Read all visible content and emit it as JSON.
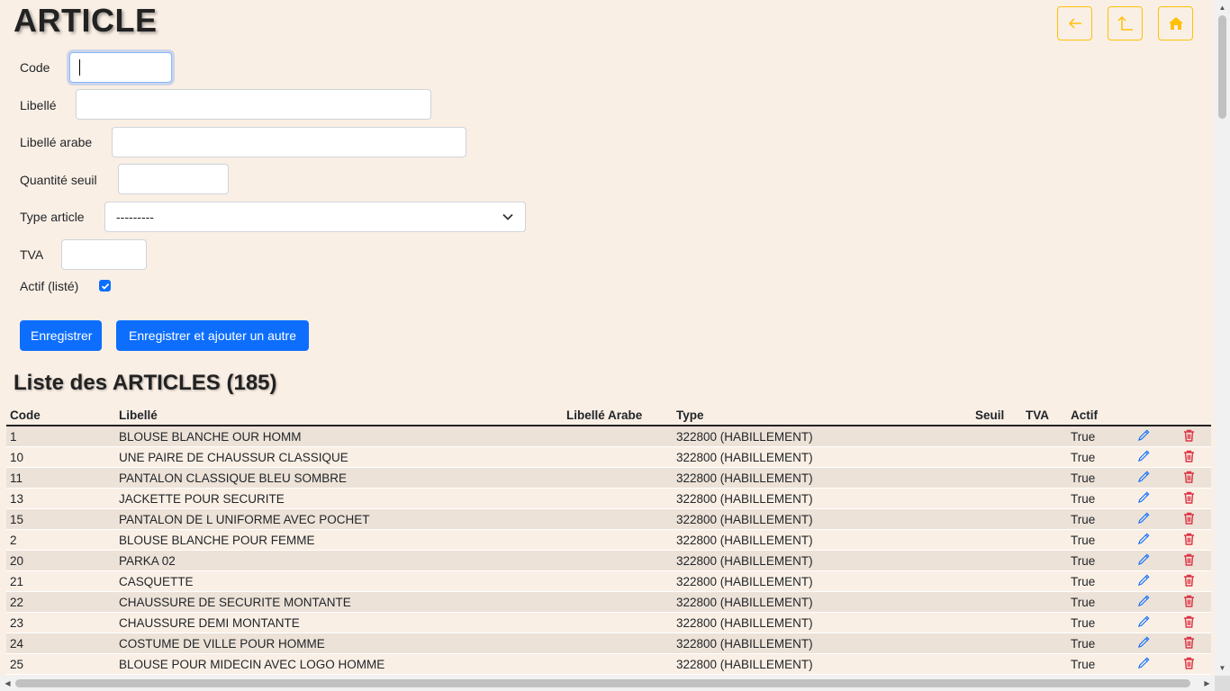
{
  "page": {
    "title": "ARTICLE"
  },
  "nav": {
    "back_icon": "arrow-left-icon",
    "up_icon": "arrow-up-icon",
    "home_icon": "home-icon",
    "accent": "#ffc107"
  },
  "form": {
    "code": {
      "label": "Code",
      "value": ""
    },
    "libelle": {
      "label": "Libellé",
      "value": ""
    },
    "libelle_arabe": {
      "label": "Libellé arabe",
      "value": ""
    },
    "quantite_seuil": {
      "label": "Quantité seuil",
      "value": ""
    },
    "type_article": {
      "label": "Type article",
      "selected": "---------"
    },
    "tva": {
      "label": "TVA",
      "value": ""
    },
    "actif": {
      "label": "Actif (listé)",
      "checked": true
    },
    "save_label": "Enregistrer",
    "save_add_label": "Enregistrer et ajouter un autre"
  },
  "list": {
    "title": "Liste des ARTICLES (185)",
    "columns": [
      "Code",
      "Libellé",
      "Libellé Arabe",
      "Type",
      "Seuil",
      "TVA",
      "Actif"
    ],
    "rows": [
      [
        "1",
        "BLOUSE BLANCHE OUR HOMM",
        "",
        "322800 (HABILLEMENT)",
        "",
        "",
        "True"
      ],
      [
        "10",
        "UNE PAIRE DE CHAUSSUR CLASSIQUE",
        "",
        "322800 (HABILLEMENT)",
        "",
        "",
        "True"
      ],
      [
        "11",
        "PANTALON CLASSIQUE BLEU SOMBRE",
        "",
        "322800 (HABILLEMENT)",
        "",
        "",
        "True"
      ],
      [
        "13",
        "JACKETTE POUR SECURITE",
        "",
        "322800 (HABILLEMENT)",
        "",
        "",
        "True"
      ],
      [
        "15",
        "PANTALON DE L UNIFORME AVEC POCHET",
        "",
        "322800 (HABILLEMENT)",
        "",
        "",
        "True"
      ],
      [
        "2",
        "BLOUSE BLANCHE POUR FEMME",
        "",
        "322800 (HABILLEMENT)",
        "",
        "",
        "True"
      ],
      [
        "20",
        "PARKA 02",
        "",
        "322800 (HABILLEMENT)",
        "",
        "",
        "True"
      ],
      [
        "21",
        "CASQUETTE",
        "",
        "322800 (HABILLEMENT)",
        "",
        "",
        "True"
      ],
      [
        "22",
        "CHAUSSURE DE SECURITE MONTANTE",
        "",
        "322800 (HABILLEMENT)",
        "",
        "",
        "True"
      ],
      [
        "23",
        "CHAUSSURE DEMI MONTANTE",
        "",
        "322800 (HABILLEMENT)",
        "",
        "",
        "True"
      ],
      [
        "24",
        "COSTUME DE VILLE POUR HOMME",
        "",
        "322800 (HABILLEMENT)",
        "",
        "",
        "True"
      ],
      [
        "25",
        "BLOUSE POUR MIDECIN AVEC LOGO HOMME",
        "",
        "322800 (HABILLEMENT)",
        "",
        "",
        "True"
      ]
    ],
    "edit_icon": "pencil-icon",
    "delete_icon": "trash-icon",
    "edit_color": "#0d6efd",
    "delete_color": "#dc3545"
  }
}
